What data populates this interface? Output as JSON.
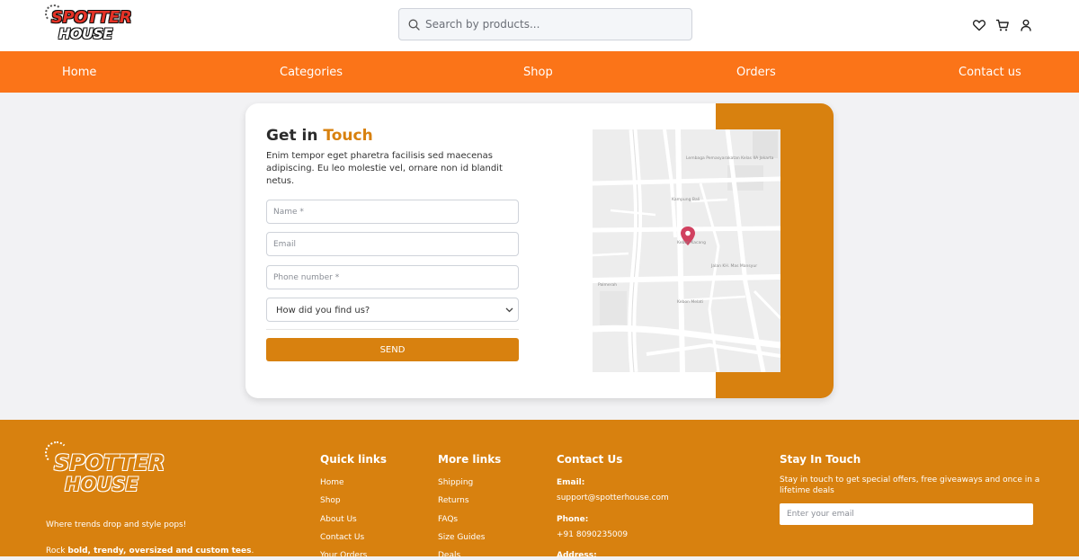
{
  "brand": {
    "logo_line1": "SPOTTER",
    "logo_line2": "HOUSE"
  },
  "search": {
    "placeholder": "Search by products..."
  },
  "header_icons": [
    "heart-icon",
    "cart-icon",
    "user-icon"
  ],
  "nav": {
    "items": [
      "Home",
      "Categories",
      "Shop",
      "Orders",
      "Contact us"
    ]
  },
  "contact_form": {
    "title_part1": "Get in",
    "title_part2": "Touch",
    "description": "Enim tempor eget pharetra facilisis sed maecenas adipiscing. Eu leo molestie vel, ornare non id blandit netus.",
    "name_placeholder": "Name *",
    "email_placeholder": "Email",
    "phone_placeholder": "Phone number *",
    "source_select": "How did you find us?",
    "send_label": "SEND"
  },
  "map": {
    "labels": [
      "Lembaga Pemasyarakatan Kelas IIA Jakarta",
      "Kampung Bali",
      "Kebon Kacang",
      "Palmerah",
      "Kebon Melati",
      "Jalan KH. Mas Mansyur"
    ]
  },
  "footer": {
    "tagline": "Where trends drop and style pops!",
    "tagline2_prefix": "Rock ",
    "tagline2_bold": "bold, trendy, oversized and custom tees",
    "tagline2_suffix": ".",
    "quick_links_title": "Quick links",
    "quick_links": [
      "Home",
      "Shop",
      "About Us",
      "Contact Us",
      "Your Orders"
    ],
    "more_links_title": "More links",
    "more_links": [
      "Shipping",
      "Returns",
      "FAQs",
      "Size Guides",
      "Deals"
    ],
    "contact_title": "Contact Us",
    "email_label": "Email:",
    "email_value": "support@spotterhouse.com",
    "phone_label": "Phone:",
    "phone_value": "+91 8090235009",
    "address_label": "Address:",
    "stay_title": "Stay In Touch",
    "stay_text": "Stay in touch to get special offers, free giveaways and once in a lifetime deals",
    "email_placeholder": "Enter your email"
  },
  "colors": {
    "nav_orange": "#fb7418",
    "accent": "#d8810f",
    "map_pin": "#d14160"
  }
}
